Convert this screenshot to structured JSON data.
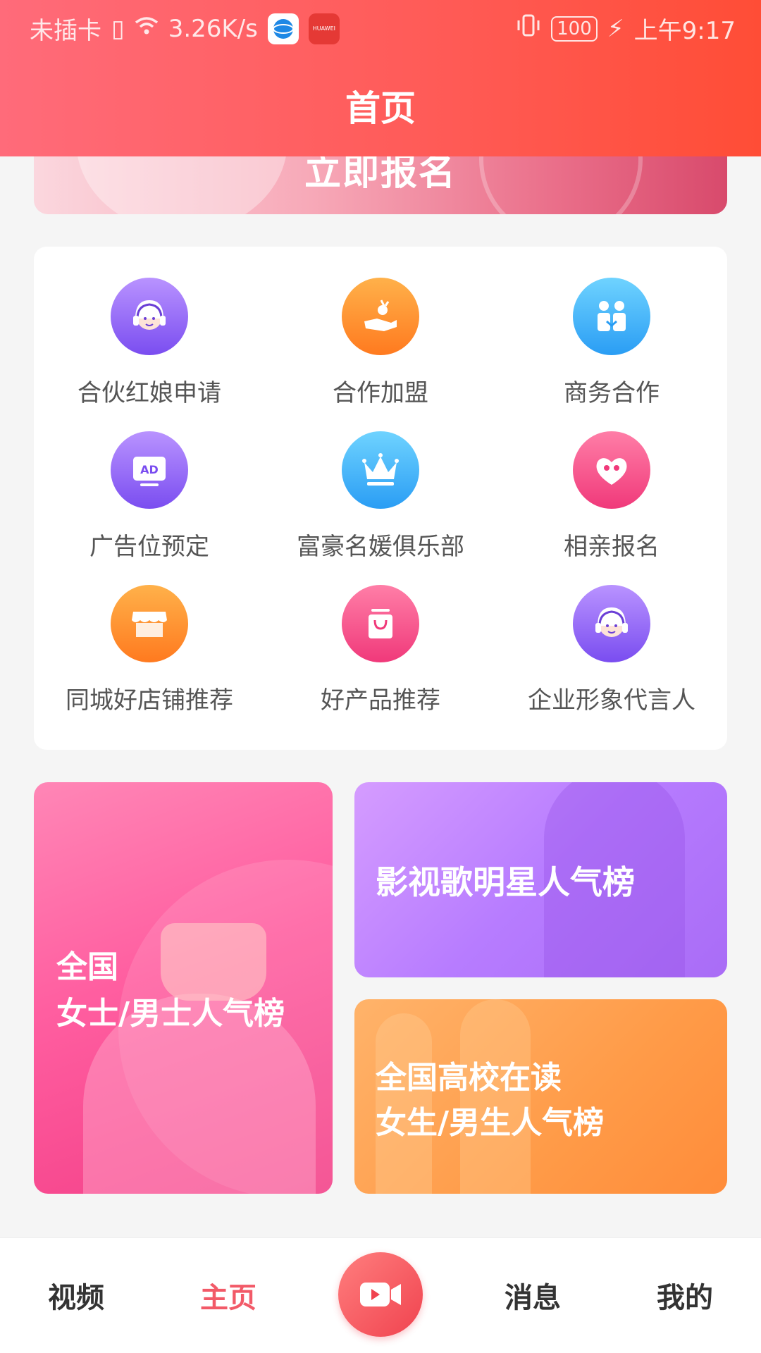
{
  "status_bar": {
    "carrier": "未插卡",
    "speed": "3.26K/s",
    "battery": "100",
    "time": "上午9:17",
    "huawei_label": "HUAWEI"
  },
  "header": {
    "title": "首页"
  },
  "banner": {
    "text": "立即报名"
  },
  "menu": {
    "items": [
      {
        "label": "合伙红娘申请",
        "icon": "headset-girl-icon",
        "color": "#8a5cf5"
      },
      {
        "label": "合作加盟",
        "icon": "handshake-icon",
        "color": "#ff8a2a"
      },
      {
        "label": "商务合作",
        "icon": "partners-icon",
        "color": "#3aa8f5"
      },
      {
        "label": "广告位预定",
        "icon": "ad-icon",
        "color": "#8a5cf5"
      },
      {
        "label": "富豪名媛俱乐部",
        "icon": "crown-icon",
        "color": "#3aa8f5"
      },
      {
        "label": "相亲报名",
        "icon": "heart-lock-icon",
        "color": "#f0477f"
      },
      {
        "label": "同城好店铺推荐",
        "icon": "shop-icon",
        "color": "#ff8a2a"
      },
      {
        "label": "好产品推荐",
        "icon": "shopping-bag-icon",
        "color": "#f0477f"
      },
      {
        "label": "企业形象代言人",
        "icon": "headset-girl-icon",
        "color": "#8a5cf5"
      }
    ]
  },
  "rankings": {
    "national": {
      "line1": "全国",
      "line2": "女士/男士人气榜"
    },
    "stars": {
      "line1": "影视歌明星人气榜"
    },
    "campus": {
      "line1": "全国高校在读",
      "line2": "女生/男生人气榜"
    }
  },
  "bottom_nav": {
    "video": "视频",
    "home": "主页",
    "messages": "消息",
    "mine": "我的",
    "active_color": "#f25a68"
  }
}
